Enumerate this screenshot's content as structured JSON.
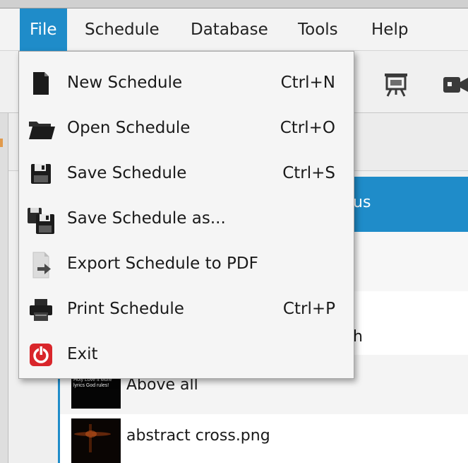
{
  "menubar": {
    "items": [
      {
        "label": "File",
        "active": true
      },
      {
        "label": "Schedule"
      },
      {
        "label": "Database"
      },
      {
        "label": "Tools"
      },
      {
        "label": "Help"
      }
    ]
  },
  "toolbar": {
    "icons": [
      "presentation-icon",
      "camera-icon"
    ]
  },
  "file_menu": {
    "items": [
      {
        "label": "New Schedule",
        "shortcut": "Ctrl+N",
        "icon": "new-document-icon"
      },
      {
        "label": "Open Schedule",
        "shortcut": "Ctrl+O",
        "icon": "folder-icon"
      },
      {
        "label": "Save Schedule",
        "shortcut": "Ctrl+S",
        "icon": "floppy-disk-icon"
      },
      {
        "label": "Save Schedule as...",
        "shortcut": "",
        "icon": "save-as-icon"
      },
      {
        "label": "Export Schedule to PDF",
        "shortcut": "",
        "icon": "export-icon"
      },
      {
        "label": "Print Schedule",
        "shortcut": "Ctrl+P",
        "icon": "printer-icon"
      },
      {
        "label": "Exit",
        "shortcut": "",
        "icon": "power-icon"
      }
    ]
  },
  "schedule_list": {
    "rows": [
      {
        "text": "us",
        "selected": true
      },
      {
        "text": ""
      },
      {
        "text": "h"
      },
      {
        "text": "Above all",
        "thumb_text": "Holy Love it More lyrics God rules!"
      },
      {
        "text": "abstract cross.png"
      }
    ]
  },
  "colors": {
    "accent": "#1f8cc9",
    "menu_bg": "#f5f5f5",
    "exit_icon": "#d9262b"
  }
}
